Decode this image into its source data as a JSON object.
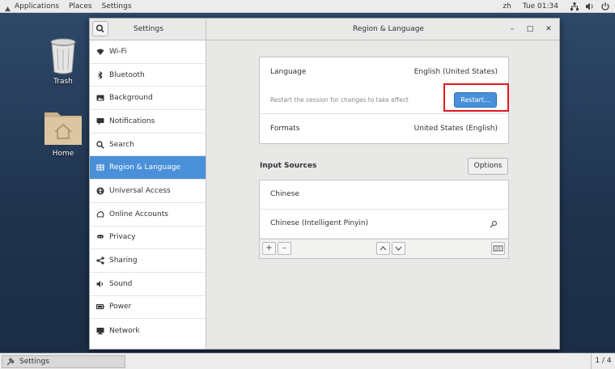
{
  "topbar": {
    "menus": [
      "Applications",
      "Places",
      "Settings"
    ],
    "input_method": "zh",
    "clock": "Tue 01:34",
    "tray_icons": [
      "network-icon",
      "volume-icon",
      "power-icon"
    ]
  },
  "desktop": {
    "icons": [
      {
        "label": "Trash",
        "icon": "trash-icon"
      },
      {
        "label": "Home",
        "icon": "home-folder-icon"
      }
    ]
  },
  "window": {
    "sidebar_title": "Settings",
    "title": "Region & Language",
    "controls": {
      "minimize": "–",
      "maximize": "□",
      "close": "✕"
    }
  },
  "sidebar": {
    "items": [
      {
        "label": "Wi-Fi",
        "icon": "wifi-icon"
      },
      {
        "label": "Bluetooth",
        "icon": "bluetooth-icon"
      },
      {
        "label": "Background",
        "icon": "background-icon"
      },
      {
        "label": "Notifications",
        "icon": "notifications-icon"
      },
      {
        "label": "Search",
        "icon": "search-icon"
      },
      {
        "label": "Region & Language",
        "icon": "region-icon",
        "active": true
      },
      {
        "label": "Universal Access",
        "icon": "universal-access-icon"
      },
      {
        "label": "Online Accounts",
        "icon": "online-accounts-icon"
      },
      {
        "label": "Privacy",
        "icon": "privacy-icon"
      },
      {
        "label": "Sharing",
        "icon": "sharing-icon"
      },
      {
        "label": "Sound",
        "icon": "sound-icon"
      },
      {
        "label": "Power",
        "icon": "power-icon"
      },
      {
        "label": "Network",
        "icon": "network-icon"
      }
    ]
  },
  "region": {
    "language_label": "Language",
    "language_value": "English (United States)",
    "restart_note": "Restart the session for changes to take effect",
    "restart_button": "Restart...",
    "formats_label": "Formats",
    "formats_value": "United States (English)"
  },
  "input_sources": {
    "heading": "Input Sources",
    "options_button": "Options",
    "items": [
      "Chinese",
      "Chinese (Intelligent Pinyin)"
    ],
    "add": "+",
    "remove": "–",
    "up_icon": "chevron-up-icon",
    "down_icon": "chevron-down-icon",
    "keyboard_icon": "keyboard-icon"
  },
  "bottombar": {
    "task_label": "Settings",
    "workspace": "1 / 4"
  },
  "colors": {
    "accent": "#4a90d9",
    "highlight_box": "#e0181f"
  }
}
